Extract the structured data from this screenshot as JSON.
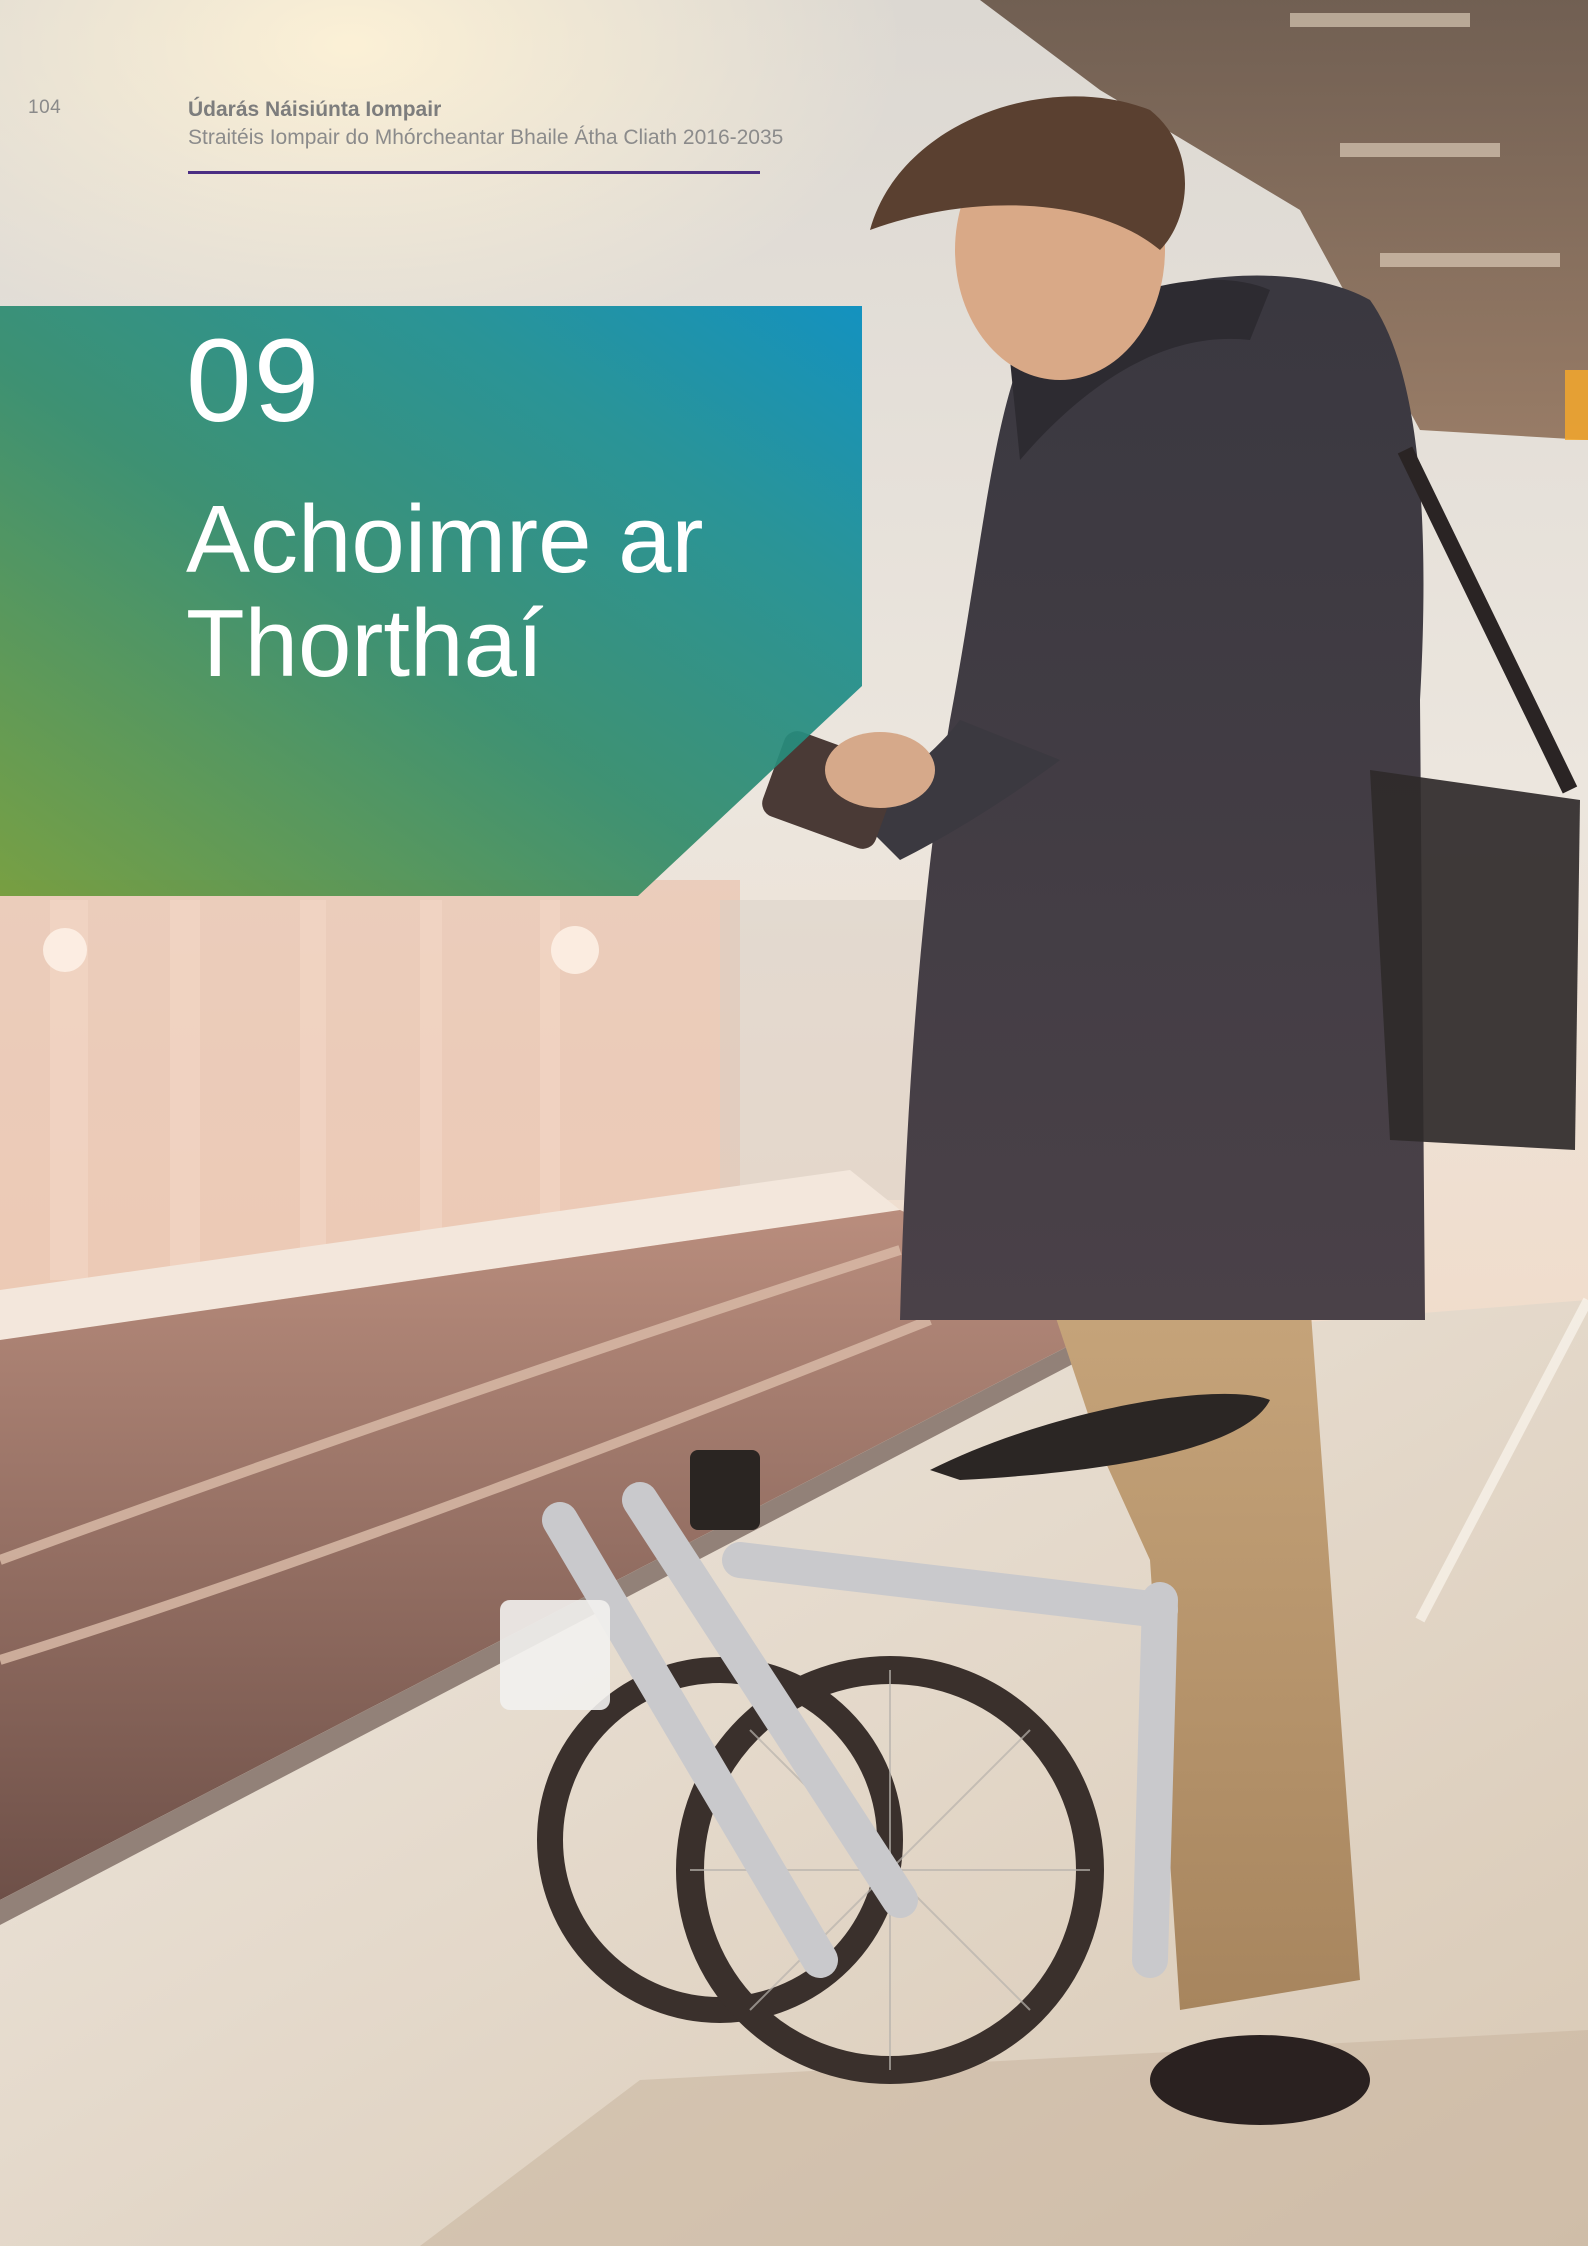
{
  "header": {
    "page_number": "104",
    "organisation": "Údarás Náisiúnta Iompair",
    "document_title": "Straitéis Iompair do Mhórcheantar Bhaile Átha Cliath 2016-2035"
  },
  "chapter": {
    "number": "09",
    "title_line1": "Achoimre ar",
    "title_line2": "Thorthaí"
  },
  "colors": {
    "rule": "#4b2e83",
    "panel_green": "#6e9a36",
    "panel_teal": "#1e8f93",
    "panel_blue": "#0b8fbf"
  }
}
